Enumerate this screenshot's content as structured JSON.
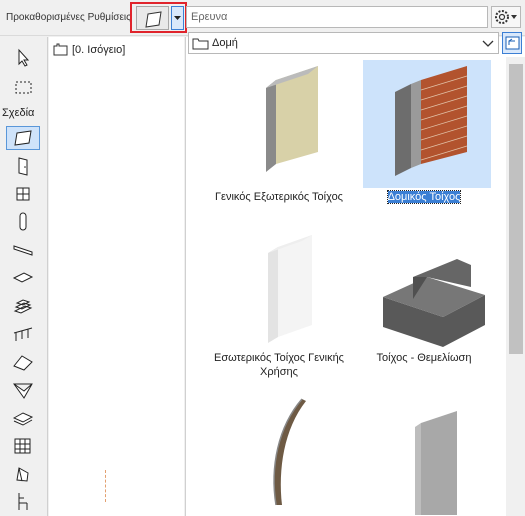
{
  "toolbar": {
    "preset_label": "Προκαθορισμένες Ρυθμίσεις",
    "search_placeholder": "Ερευνα"
  },
  "toolbox": {
    "section_label": "Σχεδία",
    "tools": [
      "arrow",
      "marquee",
      "wall",
      "door",
      "window",
      "column",
      "beam",
      "slab",
      "stair",
      "railing",
      "roof",
      "shell",
      "mesh",
      "curtain-wall",
      "object"
    ]
  },
  "navigator": {
    "story": "[0. Ισόγειο]"
  },
  "library": {
    "folder": "Δομή",
    "items": [
      {
        "label": "Γενικός Εξωτερικός Τοίχος",
        "selected": false
      },
      {
        "label": "Δομικός Τοίχος",
        "selected": true
      },
      {
        "label": "Εσωτερικός Τοίχος Γενικής Χρήσης",
        "selected": false
      },
      {
        "label": "Τοίχος - Θεμελίωση",
        "selected": false
      },
      {
        "label": "",
        "selected": false
      },
      {
        "label": "",
        "selected": false
      }
    ]
  }
}
